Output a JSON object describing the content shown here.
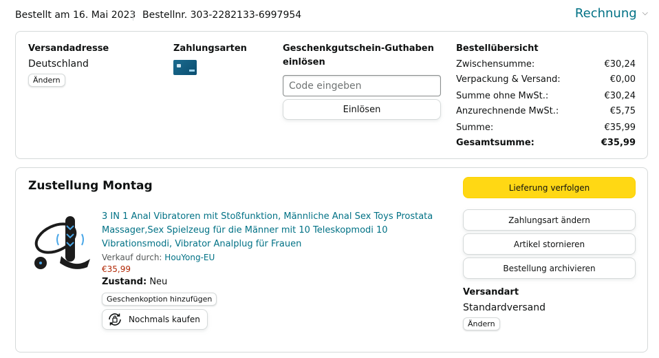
{
  "header": {
    "order_date": "Bestellt am 16. Mai 2023",
    "order_number": "Bestellnr. 303-2282133-6997954",
    "invoice_label": "Rechnung",
    "invoice_icon": "chevron-down-icon"
  },
  "address": {
    "heading": "Versandadresse",
    "country": "Deutschland",
    "change_label": "Ändern"
  },
  "payment": {
    "heading": "Zahlungsarten",
    "card_icon": "credit-card-icon"
  },
  "gift_card": {
    "heading": "Geschenkgutschein-Guthaben einlösen",
    "placeholder": "Code eingeben",
    "redeem_label": "Einlösen"
  },
  "summary": {
    "heading": "Bestellübersicht",
    "rows": [
      {
        "label": "Zwischensumme:",
        "value": "€30,24"
      },
      {
        "label": "Verpackung & Versand:",
        "value": "€0,00"
      },
      {
        "label": "Summe ohne MwSt.:",
        "value": "€30,24"
      },
      {
        "label": "Anzurechnende MwSt.:",
        "value": "€5,75"
      },
      {
        "label": "Summe:",
        "value": "€35,99"
      },
      {
        "label": "Gesamtsumme:",
        "value": "€35,99"
      }
    ]
  },
  "delivery": {
    "title": "Zustellung Montag",
    "product": {
      "title": "3 IN 1 Anal Vibratoren mit Stoßfunktion, Männliche Anal Sex Toys Prostata Massager,Sex Spielzeug für die Männer mit 10 Teleskopmodi 10 Vibrationsmodi, Vibrator Analplug für Frauen",
      "seller_prefix": "Verkauf durch:",
      "seller_name": "HouYong-EU",
      "price": "€35,99",
      "condition_label": "Zustand:",
      "condition_value": "Neu",
      "gift_option_label": "Geschenkoption hinzufügen",
      "rebuy_label": "Nochmals kaufen",
      "rebuy_icon": "rebuy-icon"
    },
    "actions": {
      "track": "Lieferung verfolgen",
      "change_payment": "Zahlungsart ändern",
      "cancel": "Artikel stornieren",
      "archive": "Bestellung archivieren"
    },
    "shipping": {
      "heading": "Versandart",
      "method": "Standardversand",
      "change_label": "Ändern"
    }
  },
  "colors": {
    "link": "#007185",
    "price": "#b12704",
    "primary_button": "#ffd814",
    "border": "#d5d9d9",
    "text": "#0f1111"
  }
}
